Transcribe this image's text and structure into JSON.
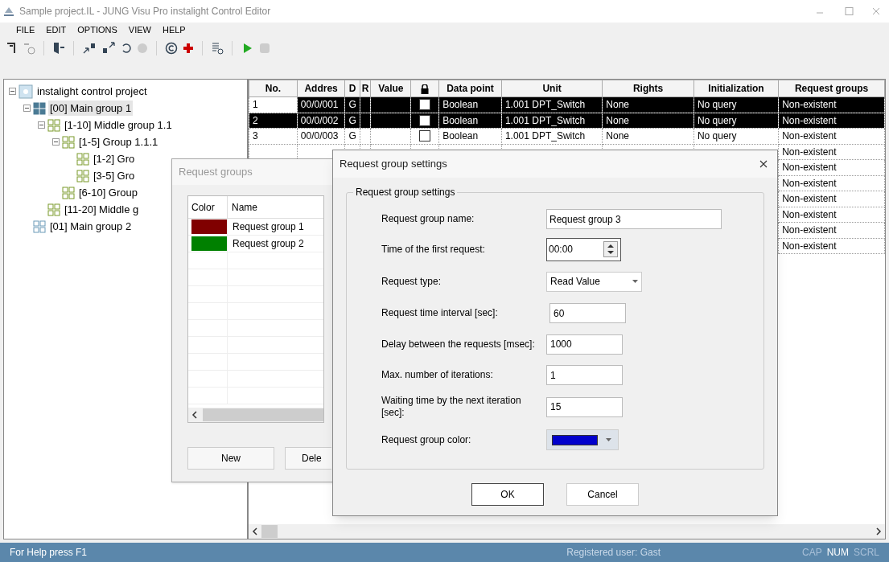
{
  "window": {
    "title": "Sample project.IL - JUNG Visu Pro instalight Control Editor"
  },
  "menu": [
    "FILE",
    "EDIT",
    "OPTIONS",
    "VIEW",
    "HELP"
  ],
  "tree": [
    {
      "label": "instalight control project",
      "kind": "project",
      "expanded": true,
      "selected": false,
      "children": [
        {
          "label": "[00] Main group 1",
          "kind": "main",
          "expanded": true,
          "selected": true,
          "children": [
            {
              "label": "[1-10] Middle group 1.1",
              "kind": "group",
              "expanded": true,
              "selected": false,
              "children": [
                {
                  "label": "[1-5] Group 1.1.1",
                  "kind": "group",
                  "expanded": true,
                  "selected": false,
                  "children": [
                    {
                      "label": "[1-2] Gro",
                      "kind": "group",
                      "selected": false
                    },
                    {
                      "label": "[3-5] Gro",
                      "kind": "group",
                      "selected": false
                    }
                  ]
                },
                {
                  "label": "[6-10] Group",
                  "kind": "group",
                  "selected": false
                }
              ]
            },
            {
              "label": "[11-20] Middle g",
              "kind": "group",
              "selected": false
            }
          ]
        },
        {
          "label": "[01] Main group 2",
          "kind": "main2",
          "selected": false
        }
      ]
    }
  ],
  "table": {
    "columns": [
      "No.",
      "Addres",
      "D",
      "R",
      "Value",
      "",
      "Data point",
      "Unit",
      "Rights",
      "Initialization",
      "Request groups"
    ],
    "rows": [
      {
        "selected": true,
        "locked": false,
        "cells": [
          "1",
          "00/0/001",
          "G",
          "",
          "",
          "",
          "Boolean",
          "1.001 DPT_Switch",
          "None",
          "No query",
          "Non-existent"
        ]
      },
      {
        "selected": true,
        "locked": false,
        "cells": [
          "2",
          "00/0/002",
          "G",
          "",
          "",
          "",
          "Boolean",
          "1.001 DPT_Switch",
          "None",
          "No query",
          "Non-existent"
        ]
      },
      {
        "selected": false,
        "locked": false,
        "cells": [
          "3",
          "00/0/003",
          "G",
          "",
          "",
          "",
          "Boolean",
          "1.001 DPT_Switch",
          "None",
          "No query",
          "Non-existent"
        ]
      },
      {
        "selected": false,
        "cells": [
          "",
          "",
          "",
          "",
          "",
          "",
          "",
          "",
          "",
          "",
          "Non-existent"
        ]
      },
      {
        "selected": false,
        "cells": [
          "",
          "",
          "",
          "",
          "",
          "",
          "",
          "",
          "",
          "",
          "Non-existent"
        ]
      },
      {
        "selected": false,
        "cells": [
          "",
          "",
          "",
          "",
          "",
          "",
          "",
          "",
          "",
          "",
          "Non-existent"
        ]
      },
      {
        "selected": false,
        "cells": [
          "",
          "",
          "",
          "",
          "",
          "",
          "",
          "",
          "",
          "",
          "Non-existent"
        ]
      },
      {
        "selected": false,
        "cells": [
          "",
          "",
          "",
          "",
          "",
          "",
          "",
          "",
          "",
          "",
          "Non-existent"
        ]
      },
      {
        "selected": false,
        "cells": [
          "",
          "",
          "",
          "",
          "",
          "",
          "",
          "",
          "",
          "",
          "Non-existent"
        ]
      },
      {
        "selected": false,
        "cells": [
          "",
          "",
          "",
          "",
          "",
          "",
          "",
          "",
          "",
          "",
          "Non-existent"
        ]
      }
    ]
  },
  "request_groups_dialog": {
    "title": "Request groups",
    "columns": [
      "Color",
      "Name"
    ],
    "items": [
      {
        "color": "#800000",
        "name": "Request group 1"
      },
      {
        "color": "#008000",
        "name": "Request group 2"
      }
    ],
    "buttons": [
      "New",
      "Dele"
    ]
  },
  "settings_dialog": {
    "title": "Request group settings",
    "group_title": "Request group settings",
    "fields": [
      {
        "kind": "text",
        "label": "Request group name:",
        "value": "Request group 3"
      },
      {
        "kind": "spinner",
        "label": "Time of the first request:",
        "value": "00:00"
      },
      {
        "kind": "dropdown",
        "label": "Request type:",
        "value": "Read Value"
      },
      {
        "kind": "number",
        "label": "Request time interval [sec]:",
        "value": "60"
      },
      {
        "kind": "number",
        "label": "Delay between the requests [msec]:",
        "value": "1000"
      },
      {
        "kind": "number",
        "label": "Max. number of iterations:",
        "value": "1"
      },
      {
        "kind": "number",
        "label": "Waiting time by the next iteration [sec]:",
        "value": "15"
      },
      {
        "kind": "color",
        "label": "Request group color:",
        "color": "#0000cc"
      }
    ],
    "buttons": [
      "OK",
      "Cancel"
    ]
  },
  "status_bar": {
    "help": "For Help press F1",
    "user": "Registered user: Gast",
    "indicators": [
      {
        "label": "CAP",
        "on": false
      },
      {
        "label": "NUM",
        "on": true
      },
      {
        "label": "SCRL",
        "on": false
      }
    ]
  }
}
